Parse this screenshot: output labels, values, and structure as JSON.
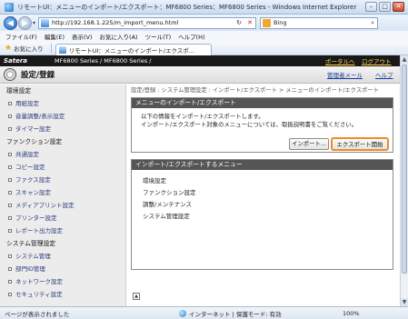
{
  "window": {
    "title": "リモートUI：メニューのインポート/エクスポート：MF6800 Series：MF6800 Series - Windows Internet Explorer",
    "minimize": "–",
    "maximize": "□",
    "close": "✕"
  },
  "address": {
    "back": "◀",
    "forward": "▶",
    "dropdown": "▾",
    "url": "http://192.168.1.225/m_import_menu.html",
    "refresh": "↻",
    "stop": "✕",
    "go": "▾",
    "search_engine": "Bing",
    "search_value": ""
  },
  "menubar": [
    "ファイル(F)",
    "編集(E)",
    "表示(V)",
    "お気に入り(A)",
    "ツール(T)",
    "ヘルプ(H)"
  ],
  "favorites": {
    "label": "お気に入り",
    "tab_title": "リモートUI：メニューのインポート/エクスポ..."
  },
  "header": {
    "brand": "Satera",
    "model": "MF6800 Series / MF6800 Series /",
    "portal_link": "ポータルへ",
    "logout_link": "ログアウト",
    "page_title": "設定/登録",
    "manager_link": "管理者メール",
    "help_link": "ヘルプ"
  },
  "sidebar": {
    "sections": [
      {
        "title": "環境設定",
        "items": [
          "用紙設定",
          "音量調整/表示設定",
          "タイマー設定"
        ]
      },
      {
        "title": "ファンクション設定",
        "items": [
          "共通設定",
          "コピー設定",
          "ファクス設定",
          "スキャン設定",
          "メディアプリント設定",
          "プリンター設定",
          "レポート出力設定"
        ]
      },
      {
        "title": "システム管理設定",
        "items": [
          "システム管理",
          "部門ID管理",
          "ネットワーク設定",
          "セキュリティ設定"
        ]
      }
    ]
  },
  "main": {
    "breadcrumb": "設定/登録 : システム管理設定 : インポート/エクスポート > メニューのインポート/エクスポート",
    "panel1_title": "メニューのインポート/エクスポート",
    "panel1_line1": "以下の情報をインポート/エクスポートします。",
    "panel1_line2": "インポート/エクスポート対象のメニューについては、取扱説明書をご覧ください。",
    "import_button": "インポート...",
    "export_button": "エクスポート開始",
    "panel2_title": "インポート/エクスポートするメニュー",
    "menu_items": [
      "環境設定",
      "ファンクション設定",
      "調整/メンテナンス",
      "システム管理設定"
    ],
    "page_top": "▲"
  },
  "statusbar": {
    "left": "ページが表示されました",
    "zone": "インターネット | 保護モード: 有効",
    "zoom": "100%"
  }
}
